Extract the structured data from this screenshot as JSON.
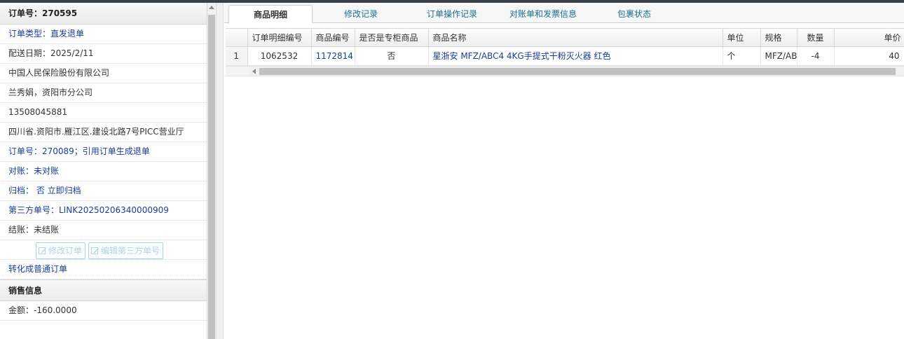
{
  "left": {
    "order_header": "订单号：270595",
    "rows": [
      {
        "text": "订单类型：直发退单",
        "style": "blue"
      },
      {
        "text": "配送日期：2025/2/11",
        "style": "dark"
      },
      {
        "text": "中国人民保险股份有限公司",
        "style": "dark"
      },
      {
        "text": "兰秀娟，资阳市分公司",
        "style": "dark"
      },
      {
        "text": "13508045881",
        "style": "dark"
      },
      {
        "text": "四川省.资阳市.雁江区.建设北路7号PICC营业厅",
        "style": "dark"
      },
      {
        "text": "订单号：270089；引用订单生成退单",
        "style": "blue"
      },
      {
        "text": "对账：未对账",
        "style": "blue"
      },
      {
        "text": "归档：  否 立即归档",
        "style": "blue"
      },
      {
        "text": "第三方单号：LINK20250206340000909",
        "style": "blue"
      },
      {
        "text": "结账：未结账",
        "style": "dark"
      }
    ],
    "buttons": {
      "modify_order": "修改订单",
      "edit_third_party": "编辑第三方单号"
    },
    "convert_link": "转化成普通订单",
    "sales_header": "销售信息",
    "amount": "金额：-160.0000"
  },
  "tabs": [
    {
      "label": "商品明细",
      "active": true
    },
    {
      "label": "修改记录",
      "active": false
    },
    {
      "label": "订单操作记录",
      "active": false
    },
    {
      "label": "对账单和发票信息",
      "active": false
    },
    {
      "label": "包裹状态",
      "active": false
    }
  ],
  "table": {
    "headers": [
      "",
      "订单明细编号",
      "商品编号",
      "是否是专柜商品",
      "商品名称",
      "单位",
      "规格",
      "数量",
      "单价"
    ],
    "rows": [
      [
        "1",
        "1062532",
        "1172814",
        "否",
        "星浙安 MFZ/ABC4 4KG手提式干粉灭火器 红色",
        "个",
        "MFZ/AB",
        "-4",
        "40"
      ]
    ]
  },
  "colors": {
    "link": "#1a3d9c",
    "tab_text": "#1a6e8e",
    "button_border": "#a8d3e4"
  }
}
